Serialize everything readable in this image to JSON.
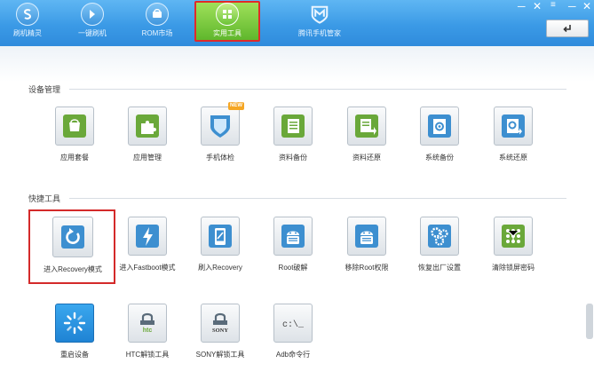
{
  "topbar": {
    "nav": [
      {
        "label": "刷机精灵",
        "icon": "logo-s-icon"
      },
      {
        "label": "一键刷机",
        "icon": "lightning-icon"
      },
      {
        "label": "ROM市场",
        "icon": "rom-market-icon"
      },
      {
        "label": "实用工具",
        "icon": "tools-grid-icon",
        "active": true
      },
      {
        "label": "腾讯手机管家",
        "icon": "tencent-manager-icon"
      }
    ],
    "window_controls": {
      "minimize": "─",
      "close": "✕"
    }
  },
  "sections": {
    "device": {
      "title": "设备管理",
      "items": [
        {
          "label": "应用套餐",
          "icon": "app-bundle-icon"
        },
        {
          "label": "应用管理",
          "icon": "puzzle-icon"
        },
        {
          "label": "手机体检",
          "icon": "shield-check-icon",
          "badge": "NEW"
        },
        {
          "label": "资料备份",
          "icon": "backup-icon"
        },
        {
          "label": "资料还原",
          "icon": "restore-icon"
        },
        {
          "label": "系统备份",
          "icon": "system-backup-icon"
        },
        {
          "label": "系统还原",
          "icon": "system-restore-icon"
        }
      ]
    },
    "quick": {
      "title": "快捷工具",
      "items": [
        {
          "label": "进入Recovery模式",
          "icon": "recovery-refresh-icon",
          "highlighted": true
        },
        {
          "label": "进入Fastboot模式",
          "icon": "fastboot-bolt-icon"
        },
        {
          "label": "刷入Recovery",
          "icon": "flash-recovery-icon"
        },
        {
          "label": "Root破解",
          "icon": "android-root-icon"
        },
        {
          "label": "移除Root权限",
          "icon": "android-unroot-icon"
        },
        {
          "label": "恢复出厂设置",
          "icon": "factory-reset-gears-icon"
        },
        {
          "label": "清除锁屏密码",
          "icon": "pattern-lock-icon"
        },
        {
          "label": "重启设备",
          "icon": "reboot-icon"
        },
        {
          "label": "HTC解锁工具",
          "icon": "htc-unlock-icon",
          "sublabel": "htc"
        },
        {
          "label": "SONY解锁工具",
          "icon": "sony-unlock-icon",
          "sublabel": "SONY"
        },
        {
          "label": "Adb命令行",
          "icon": "adb-terminal-icon",
          "sublabel": "c:\\_"
        }
      ]
    }
  },
  "colors": {
    "topbar": "#3b9ae6",
    "active_tab": "#6cc437",
    "highlight_border": "#d42a2a"
  }
}
